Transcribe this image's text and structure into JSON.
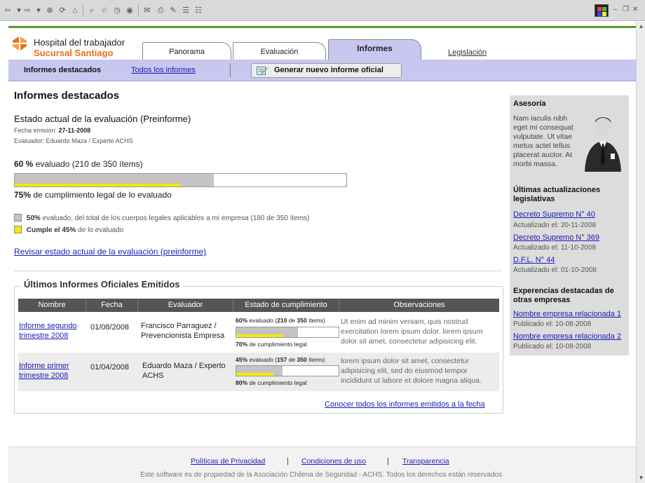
{
  "header": {
    "hospital": "Hospital del trabajador",
    "branch": "Sucursal Santiago",
    "tabs": [
      {
        "label": "Panorama"
      },
      {
        "label": "Evaluación"
      },
      {
        "label": "Informes",
        "active": true
      }
    ],
    "legislacion": "Legislación"
  },
  "subnav": {
    "current": "Informes destacados",
    "all_link": "Todos los informes",
    "generate_button": "Generar nuevo informe oficial"
  },
  "main": {
    "title": "Informes destacados",
    "eval_title": "Estado actual de la evaluación (Preinforme)",
    "fecha_label": "Fecha emisión:",
    "fecha_value": "27-11-2008",
    "evaluador": "Evaluador: Eduardo Maza / Experto ACHS",
    "evaluated_pct": "60 %",
    "evaluated_detail": "evaluado (210 de 350 ítems)",
    "evaluated_fraction": 0.6,
    "compliance_fraction": 0.5,
    "compliance_pct": "75%",
    "compliance_text": "de cumplimiento legal de lo evaluado",
    "legend_gray_pct": "50%",
    "legend_gray_text": "evaluado, del total de los cuerpos legales aplicables a mi empresa (180 de 350 ítems)",
    "legend_yellow_text": "Cumple el 45%",
    "legend_yellow_rest": "de lo evaluado",
    "review_link": "Revisar estado actual de la evaluación (preinforme)"
  },
  "reports": {
    "section_title": "Últimos Informes Oficiales Emitidos",
    "columns": [
      "Nombre",
      "Fecha",
      "Evaluador",
      "Estado de cumplimiento",
      "Observaciones"
    ],
    "rows": [
      {
        "name": "Informe segundo trimestre 2008",
        "date": "01/08/2008",
        "evaluator": "Francisco Parraguez / Prevencionista Empresa",
        "eval_pct": "60%",
        "eval_word": "evaluado",
        "eval_n": "210",
        "eval_of": "de",
        "eval_total": "350",
        "eval_items": "ítems",
        "eval_fraction": 0.6,
        "comp_fraction": 0.45,
        "comp_pct": "70%",
        "comp_text": "de cumplimiento legal",
        "observations": "Ut enim ad minim veniam, quis nostrud exercitation lorem ipsum dolor. lorem ipsum dolor sit amet, consectetur adipisicing elit."
      },
      {
        "name": "Informe primer trimestre 2008",
        "date": "01/04/2008",
        "evaluator": "Eduardo Maza / Experto ACHS",
        "eval_pct": "45%",
        "eval_word": "evaluado",
        "eval_n": "157",
        "eval_of": "de",
        "eval_total": "350",
        "eval_items": "ítems",
        "eval_fraction": 0.45,
        "comp_fraction": 0.36,
        "comp_pct": "80%",
        "comp_text": "de cumplimiento legal",
        "observations": "lorem ipsum dolor sit amet, consectetur adipisicing elit, sed do eiusmod tempor incididunt ut labore et dolore magna aliqua."
      }
    ],
    "see_all": "Conocer todos los informes emitidos a la fecha"
  },
  "sidebar": {
    "asesoria_title": "Asesoría",
    "asesoria_text": "Nam iaculis nibh eget mi consequat vulputate. Ut vitae metus actel tellus placerat auctor. At morbi massa.",
    "updates_title": "Últimas actualizaciones legislativas",
    "updates": [
      {
        "label": "Decreto Supremo N° 40",
        "date": "Actualizado el: 20-11-2008"
      },
      {
        "label": "Decreto Supremo N° 369",
        "date": "Actualizado el: 11-10-2008"
      },
      {
        "label": "D.F.L. N° 44",
        "date": "Actualizado el: 01-10-2008"
      }
    ],
    "experiences_title": "Experencias destacadas de otras empresas",
    "experiences": [
      {
        "label": "Nombre empresa relacionada 1",
        "date": "Publicado el: 10-08-2008"
      },
      {
        "label": "Nombre empresa relacionada 2",
        "date": "Publicado el: 10-08-2008"
      }
    ]
  },
  "footer": {
    "privacy": "Políticas de Privacidad",
    "terms": "Condiciones de uso",
    "transparency": "Transparencia",
    "separator": "|",
    "copyright": "Este software es de propiedad de la Asociación Chilena de Seguridad - ACHS. Todos los derechos están reservados"
  },
  "colors": {
    "accent": "#c8c7f0",
    "brand_orange": "#e8711c",
    "brand_green": "#5a9a2e",
    "evaluated": "#c4c4c4",
    "compliance": "#f5e800",
    "link": "#1a1ab8"
  },
  "icons": {
    "toolbar": [
      "back-icon",
      "forward-icon",
      "stop-icon",
      "refresh-icon",
      "home-icon",
      "search-icon",
      "favorites-icon",
      "history-icon",
      "mail-icon",
      "print-icon",
      "edit-icon",
      "discuss-icon"
    ],
    "generate": "report-edit-icon",
    "avatar": "advisor-avatar-icon"
  }
}
